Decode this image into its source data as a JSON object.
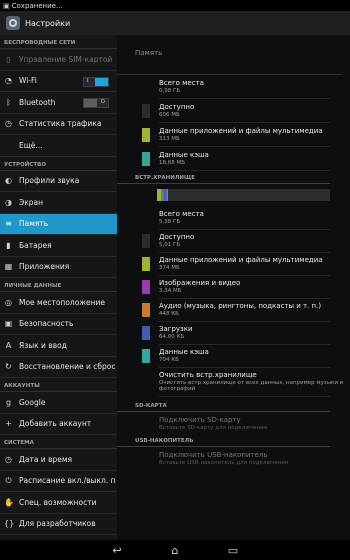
{
  "status_bar": {
    "notification": "Сохранение..."
  },
  "action_bar": {
    "title": "Настройки"
  },
  "left": {
    "sections": [
      {
        "header": "БЕСПРОВОДНЫЕ СЕТИ",
        "items": [
          {
            "label": "Управление SIM-картой",
            "icon": "sim-icon",
            "disabled": true
          },
          {
            "label": "Wi-Fi",
            "icon": "wifi-icon",
            "toggle": "on",
            "toggle_text": "I"
          },
          {
            "label": "Bluetooth",
            "icon": "bluetooth-icon",
            "toggle": "off",
            "toggle_text": "O"
          },
          {
            "label": "Статистика трафика",
            "icon": "data-usage-icon"
          },
          {
            "label": "Ещё...",
            "icon": ""
          }
        ]
      },
      {
        "header": "УСТРОЙСТВО",
        "items": [
          {
            "label": "Профили звука",
            "icon": "sound-icon"
          },
          {
            "label": "Экран",
            "icon": "display-icon"
          },
          {
            "label": "Память",
            "icon": "storage-icon",
            "selected": true
          },
          {
            "label": "Батарея",
            "icon": "battery-icon"
          },
          {
            "label": "Приложения",
            "icon": "apps-icon"
          }
        ]
      },
      {
        "header": "ЛИЧНЫЕ ДАННЫЕ",
        "items": [
          {
            "label": "Мое местоположение",
            "icon": "location-icon"
          },
          {
            "label": "Безопасность",
            "icon": "lock-icon"
          },
          {
            "label": "Язык и ввод",
            "icon": "language-icon"
          },
          {
            "label": "Восстановление и сброс",
            "icon": "backup-icon"
          }
        ]
      },
      {
        "header": "АККАУНТЫ",
        "items": [
          {
            "label": "Google",
            "icon": "google-icon"
          },
          {
            "label": "Добавить аккаунт",
            "icon": "add-icon"
          }
        ]
      },
      {
        "header": "СИСТЕМА",
        "items": [
          {
            "label": "Дата и время",
            "icon": "clock-icon"
          },
          {
            "label": "Расписание вкл./выкл. п",
            "icon": "power-schedule-icon"
          },
          {
            "label": "Спец. возможности",
            "icon": "accessibility-icon"
          },
          {
            "label": "Для разработчиков",
            "icon": "developer-icon"
          }
        ]
      }
    ]
  },
  "right": {
    "title": "Память",
    "top_items": [
      {
        "label": "Всего места",
        "value": "0,98 ГБ",
        "color": ""
      },
      {
        "label": "Доступно",
        "value": "606 МБ",
        "color": "#2a2d30"
      },
      {
        "label": "Данные приложений и файлы мультимедиа",
        "value": "313 МБ",
        "color": "#a5b22c"
      },
      {
        "label": "Данные кэша",
        "value": "18,68 МБ",
        "color": "#34a79a"
      }
    ],
    "internal_header": "ВСТР.ХРАНИЛИЩЕ",
    "usage_bar": [
      {
        "fraction": 0.025,
        "color": "#a5b22c"
      },
      {
        "fraction": 0.01,
        "color": "#3e8f9c"
      },
      {
        "fraction": 0.008,
        "color": "#b5563c"
      },
      {
        "fraction": 0.008,
        "color": "#7a4aa6"
      },
      {
        "fraction": 0.006,
        "color": "#4a6fb0"
      },
      {
        "fraction": 0.006,
        "color": "#34a79a"
      }
    ],
    "internal_items": [
      {
        "label": "Всего места",
        "value": "5,38 ГБ",
        "color": ""
      },
      {
        "label": "Доступно",
        "value": "5,01 ГБ",
        "color": "#2a2d30"
      },
      {
        "label": "Данные приложений и файлы мультимедиа",
        "value": "374 МБ",
        "color": "#a5b22c"
      },
      {
        "label": "Изображения и видео",
        "value": "3,34 МБ",
        "color": "#9a3cb0"
      },
      {
        "label": "Аудио (музыка, рингтоны, подкасты и т. п.)",
        "value": "448 КБ",
        "color": "#c97a2a"
      },
      {
        "label": "Загрузки",
        "value": "64,00 КБ",
        "color": "#3f5fae"
      },
      {
        "label": "Данные кэша",
        "value": "704 КБ",
        "color": "#34a79a"
      },
      {
        "label": "Очистить встр.хранилище",
        "value": "Очистить встр.хранилище от всех данных, например музыки и фотографий",
        "color": ""
      }
    ],
    "sd_header": "SD-КАРТА",
    "sd_item": {
      "label": "Подключить SD-карту",
      "value": "Вставьте SD-карту для подключения"
    },
    "usb_header": "USB-НАКОПИТЕЛЬ",
    "usb_item": {
      "label": "Подключить USB-накопитель",
      "value": "Вставьте USB-накопитель для подключения"
    }
  },
  "nav_bar": {
    "back": "↩",
    "home": "⌂",
    "recents": "▭"
  }
}
